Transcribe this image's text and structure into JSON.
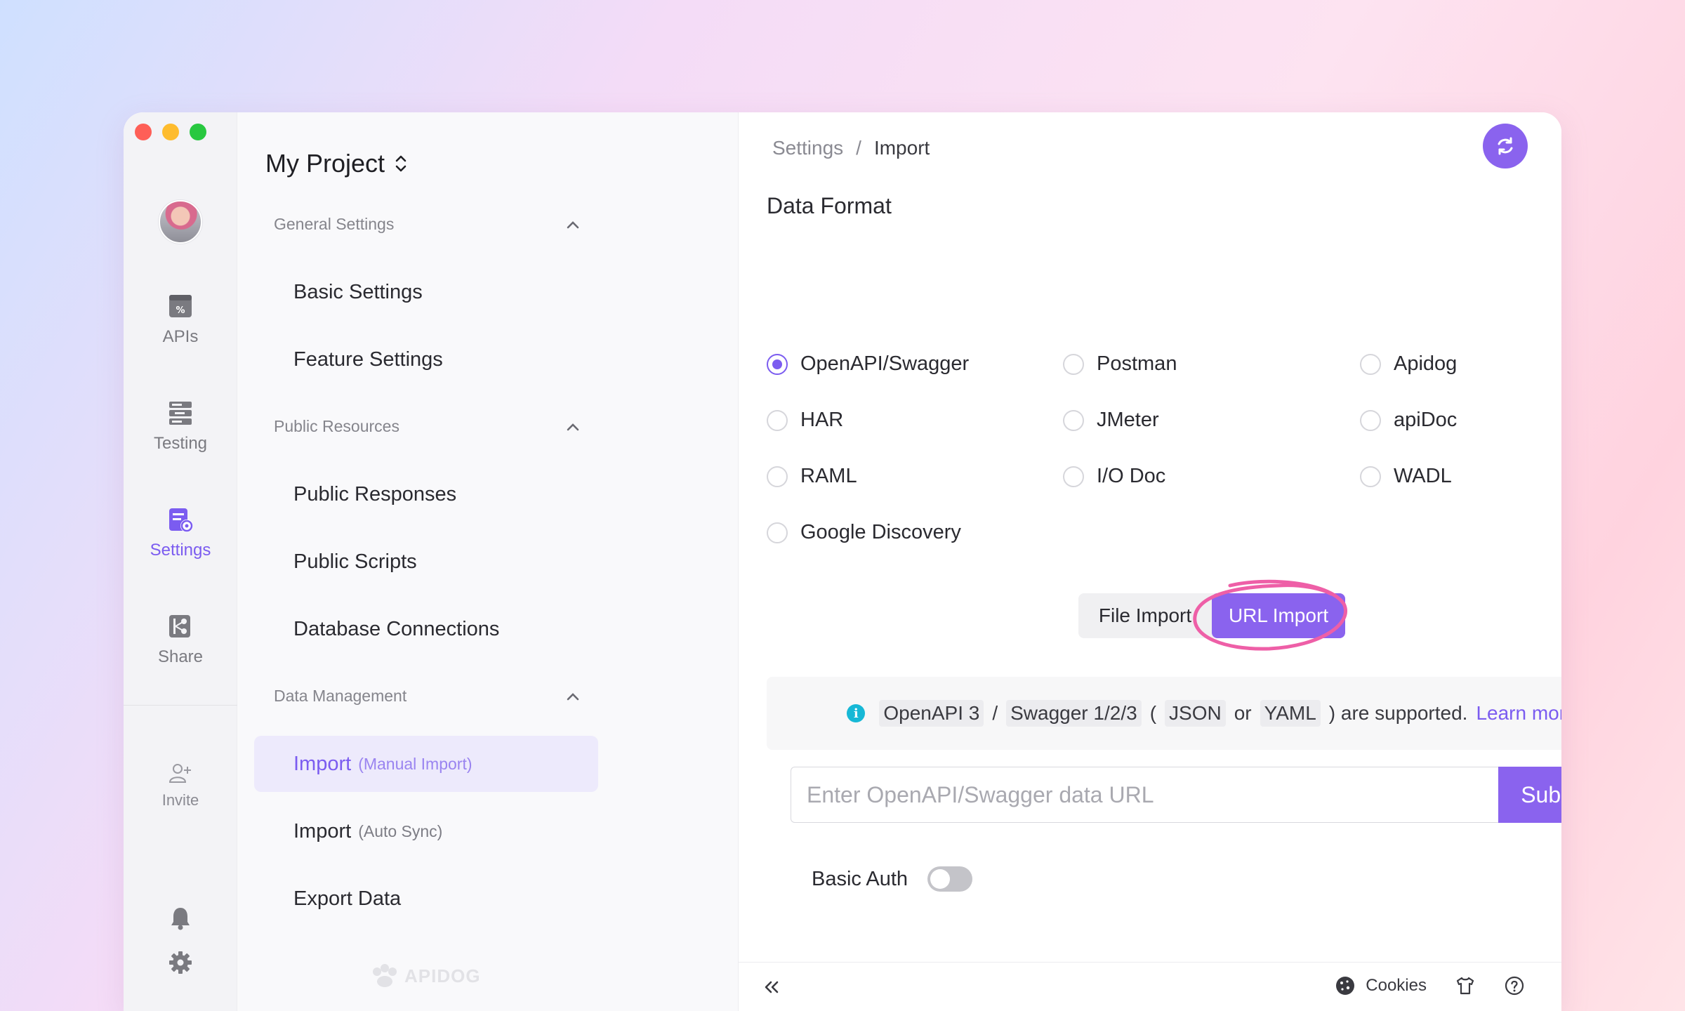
{
  "window": {
    "title": "My Project"
  },
  "rail": {
    "items": [
      {
        "label": "APIs",
        "icon": "apis-icon"
      },
      {
        "label": "Testing",
        "icon": "testing-icon"
      },
      {
        "label": "Settings",
        "icon": "settings-icon",
        "active": true
      },
      {
        "label": "Share",
        "icon": "share-icon"
      }
    ],
    "invite_label": "Invite",
    "bottom_icons": [
      "bell-icon",
      "gear-icon"
    ]
  },
  "sidebar": {
    "project_name": "My Project",
    "groups": [
      {
        "title": "General Settings",
        "items": [
          {
            "label": "Basic Settings"
          },
          {
            "label": "Feature Settings"
          }
        ]
      },
      {
        "title": "Public Resources",
        "items": [
          {
            "label": "Public Responses"
          },
          {
            "label": "Public Scripts"
          },
          {
            "label": "Database Connections"
          }
        ]
      },
      {
        "title": "Data Management",
        "items": [
          {
            "label": "Import",
            "sub": "(Manual Import)",
            "active": true
          },
          {
            "label": "Import",
            "sub": "(Auto Sync)"
          },
          {
            "label": "Export Data"
          }
        ]
      }
    ],
    "brand": "APIDOG"
  },
  "main": {
    "breadcrumb": [
      "Settings",
      "/",
      "Import"
    ],
    "section_title": "Data Format",
    "formats": [
      {
        "label": "OpenAPI/Swagger",
        "checked": true
      },
      {
        "label": "Postman"
      },
      {
        "label": "Apidog"
      },
      {
        "label": "HAR"
      },
      {
        "label": "JMeter"
      },
      {
        "label": "apiDoc"
      },
      {
        "label": "RAML"
      },
      {
        "label": "I/O Doc"
      },
      {
        "label": "WADL"
      },
      {
        "label": "Google Discovery"
      }
    ],
    "import_tabs": {
      "file": "File Import",
      "url": "URL Import",
      "selected": "URL Import"
    },
    "info": {
      "tag1": "OpenAPI 3",
      "slash": "/",
      "tag2": "Swagger 1/2/3",
      "open": "(",
      "tag3": "JSON",
      "or": "or",
      "tag4": "YAML",
      "tail": ") are supported.",
      "link": "Learn more"
    },
    "url_input": {
      "placeholder": "Enter OpenAPI/Swagger data URL",
      "value": ""
    },
    "submit_label": "Submit",
    "basic_auth_label": "Basic Auth",
    "basic_auth_on": false
  },
  "footer": {
    "cookies_label": "Cookies"
  },
  "colors": {
    "accent": "#8a63ee",
    "highlight_mark": "#ee5fa7",
    "info": "#17b8d6"
  }
}
